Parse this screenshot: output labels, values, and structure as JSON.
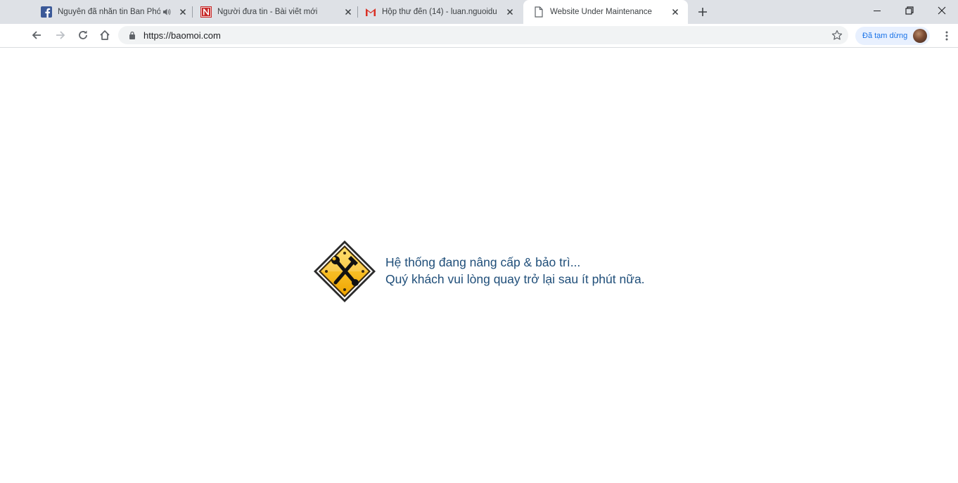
{
  "browser": {
    "tabs": [
      {
        "title": "Nguyễn đã nhắn tin Ban Phó",
        "favicon": "facebook-icon",
        "audio": true,
        "active": false
      },
      {
        "title": "Người đưa tin - Bài viết mới",
        "favicon": "nguoiduatin-icon",
        "audio": false,
        "active": false
      },
      {
        "title": "Hộp thư đến (14) - luan.nguoidu",
        "favicon": "gmail-icon",
        "audio": false,
        "active": false
      },
      {
        "title": "Website Under Maintenance",
        "favicon": "page-icon",
        "audio": false,
        "active": true
      }
    ],
    "url": "https://baomoi.com",
    "profile_status": "Đã tạm dừng"
  },
  "page": {
    "line1": "Hệ thống đang nâng cấp & bảo trì...",
    "line2": "Quý khách vui lòng quay trở lại sau ít phút nữa."
  },
  "colors": {
    "tabstrip_bg": "#dee1e6",
    "omnibox_bg": "#f1f3f4",
    "paused_bg": "#e8f0fe",
    "paused_text": "#1a73e8",
    "message_text": "#1f4e79",
    "sign_yellow": "#f5b400"
  }
}
